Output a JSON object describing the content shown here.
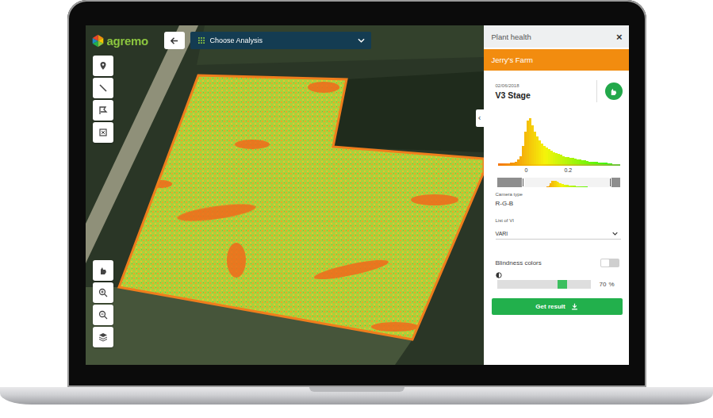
{
  "app": {
    "logo": "agremo"
  },
  "analysis_select": {
    "label": "Choose Analysis"
  },
  "panel": {
    "title": "Plant health",
    "close": "×",
    "farm": "Jerry's Farm",
    "date": "02/06/2018",
    "stage": "V3 Stage",
    "collapse": "‹"
  },
  "histogram": {
    "values": [
      1,
      1,
      1,
      2,
      2,
      3,
      4,
      6,
      10,
      18,
      40,
      70,
      95,
      100,
      85,
      70,
      60,
      52,
      45,
      40,
      36,
      32,
      29,
      26,
      24,
      22,
      20,
      18,
      16,
      15,
      14,
      13,
      12,
      11,
      10,
      9,
      8,
      7,
      6,
      6,
      5,
      5,
      4,
      4,
      3,
      3,
      2,
      2
    ],
    "ticks": [
      "0",
      "0.2"
    ]
  },
  "range_slider": {
    "low": 0.2,
    "high": 0.93
  },
  "camera": {
    "label": "Camera type",
    "value": "R-G-B"
  },
  "vi": {
    "label": "List of VI",
    "value": "VARI"
  },
  "blindness": {
    "label": "Blindness colors",
    "on": false
  },
  "opacity": {
    "level": 0.7,
    "value": "70",
    "unit": "%"
  },
  "button": {
    "label": "Get result"
  }
}
